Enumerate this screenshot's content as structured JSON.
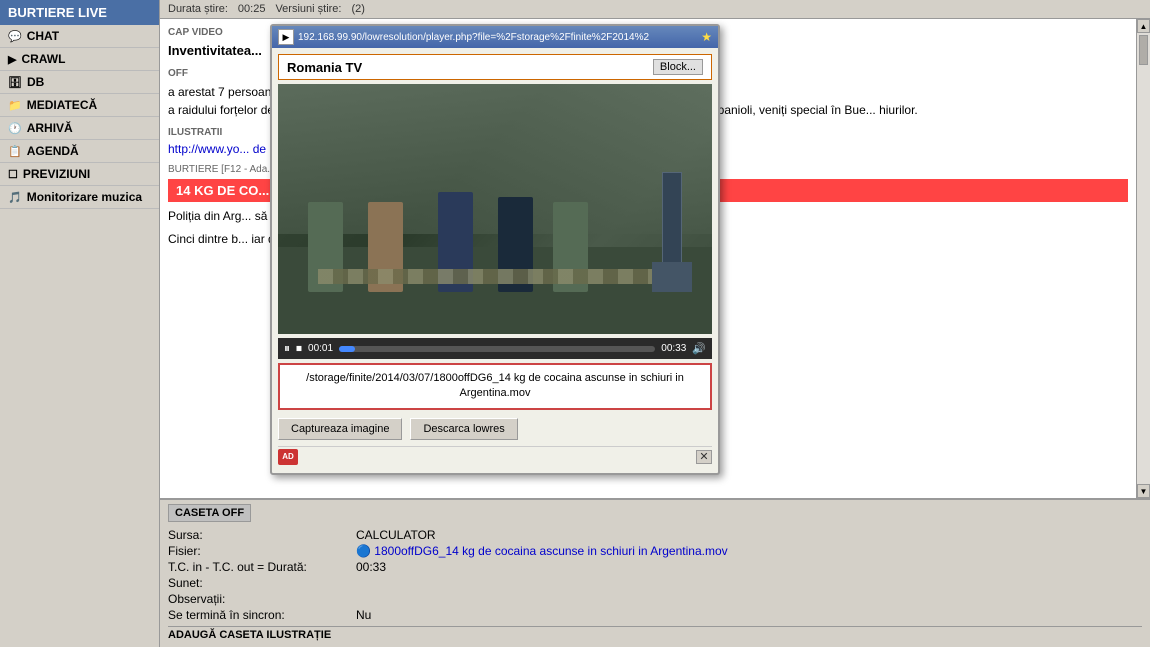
{
  "sidebar": {
    "header": "BURTIERE LIVE",
    "items": [
      {
        "id": "chat",
        "label": "CHAT",
        "icon": "💬"
      },
      {
        "id": "crawl",
        "label": "CRAWL",
        "icon": "▶"
      },
      {
        "id": "db",
        "label": "DB",
        "icon": "🗄"
      },
      {
        "id": "mediateca",
        "label": "MEDIATECĂ",
        "icon": "📁"
      },
      {
        "id": "arhiva",
        "label": "ARHIVĂ",
        "icon": "🕐"
      },
      {
        "id": "agenda",
        "label": "AGENDĂ",
        "icon": "📋"
      },
      {
        "id": "previziuni",
        "label": "PREVIZIUNI",
        "icon": "☐"
      },
      {
        "id": "monitorizare",
        "label": "Monitorizare muzica",
        "icon": "🎵"
      }
    ]
  },
  "news_header": {
    "duration_label": "Durata știre:",
    "duration_value": "00:25",
    "versions_label": "Versiuni știre:",
    "versions_value": "(2)"
  },
  "cap_video": {
    "section_label": "CAP VIDEO",
    "title": "Inventivitatea..."
  },
  "off_section": {
    "label": "OFF",
    "body": "a arestat 7 persoane care încercau să transporte 14 kilograme de... a raidului forțelor de ordine, au fost confiscate 24 de kilograme de... nuți erau argentinieni, iar doi erau spanioli, veniți special în Bue... hiurilor."
  },
  "ilustratii": {
    "label": "ILUSTRATII",
    "text": "http://www.yo... de la 0.52"
  },
  "burtiere_label": "BURTIERE [F12 - Ada...",
  "ticker": {
    "text": "14 KG DE CO..."
  },
  "news_items": [
    {
      "text": "Poliția din Arg... să transporte..."
    },
    {
      "text": "Cinci dintre b... iar doi dintre e..."
    }
  ],
  "video_modal": {
    "url": "192.168.99.90/lowresolution/player.php?file=%2Fstorage%2Ffinite%2F2014%2",
    "player_title": "Romania TV",
    "block_btn": "Block...",
    "filename": "/storage/finite/2014/03/07/1800offDG6_14 kg de cocaina ascunse in schiuri in Argentina.mov",
    "capture_btn": "Captureaza imagine",
    "download_btn": "Descarca lowres",
    "controls": {
      "play_time": "00:01",
      "end_time": "00:33"
    }
  },
  "caseta": {
    "header": "CASETA OFF",
    "sursa_label": "Sursa:",
    "sursa_value": "CALCULATOR",
    "fisier_label": "Fisier:",
    "fisier_value": "1800offDG6_14 kg de cocaina ascunse in schiuri in Argentina.mov",
    "tc_label": "T.C. in - T.C. out = Durată:",
    "tc_value": "00:33",
    "sunet_label": "Sunet:",
    "sunet_value": "",
    "observatii_label": "Observații:",
    "observatii_value": "",
    "sincron_label": "Se termină în sincron:",
    "sincron_value": "Nu"
  },
  "adauga_label": "ADAUGĂ CASETA ILUSTRAȚIE"
}
